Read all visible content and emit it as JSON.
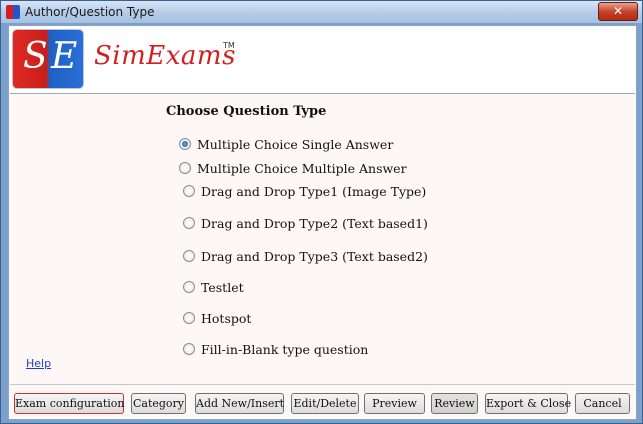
{
  "window": {
    "title": "Author/Question Type",
    "close_label": "✕"
  },
  "logo": {
    "mark_s": "S",
    "mark_e": "E",
    "name": "SimExams",
    "tm": "TM"
  },
  "content": {
    "heading": "Choose Question Type",
    "options": [
      {
        "label": "Multiple Choice Single Answer",
        "selected": true
      },
      {
        "label": "Multiple Choice Multiple Answer",
        "selected": false
      },
      {
        "label": "Drag and Drop Type1 (Image Type)",
        "selected": false
      },
      {
        "label": "Drag and Drop Type2 (Text based1)",
        "selected": false
      },
      {
        "label": "Drag and Drop Type3 (Text based2)",
        "selected": false
      },
      {
        "label": "Testlet",
        "selected": false
      },
      {
        "label": "Hotspot",
        "selected": false
      },
      {
        "label": "Fill-in-Blank type question",
        "selected": false
      }
    ],
    "help_link": "Help"
  },
  "buttons": {
    "exam_config": "Exam configuration",
    "category": "Category",
    "add_new": "Add New/Insert",
    "edit_delete": "Edit/Delete",
    "preview": "Preview",
    "review": "Review",
    "export_close": "Export & Close",
    "cancel": "Cancel"
  },
  "colors": {
    "title_gradient": "#b6cde8",
    "close": "#c7432b",
    "logo_red": "#d42020",
    "logo_blue": "#2a6fd8",
    "link": "#1e3fcc"
  }
}
